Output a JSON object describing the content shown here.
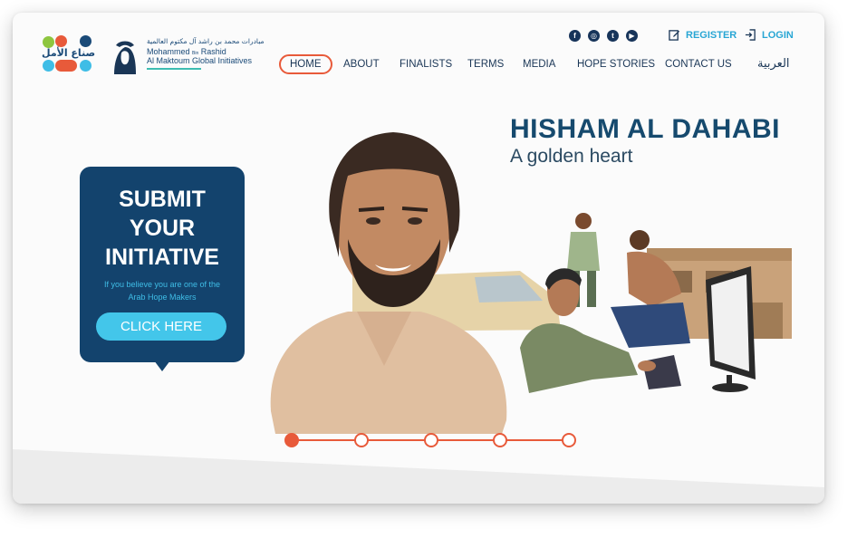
{
  "brand": {
    "hope_makers_arabic": "صناع الأمل",
    "org_arabic": "مبادرات محمد بن راشد آل مكتوم العالمية",
    "org_line1": "Mohammed",
    "org_line1_small": "Bin",
    "org_line1_rest": "Rashid",
    "org_line2": "Al Maktoum Global Initiatives"
  },
  "social": [
    {
      "icon": "facebook-icon",
      "glyph": "f"
    },
    {
      "icon": "instagram-icon",
      "glyph": "◎"
    },
    {
      "icon": "twitter-icon",
      "glyph": "t"
    },
    {
      "icon": "youtube-icon",
      "glyph": "▶"
    }
  ],
  "auth": {
    "register_label": "REGISTER",
    "login_label": "LOGIN"
  },
  "nav": {
    "home": "HOME",
    "about": "ABOUT",
    "finalists": "FINALISTS",
    "terms": "TERMS",
    "media": "MEDIA",
    "hope_stories": "HOPE STORIES",
    "contact_us": "CONTACT US",
    "language": "العربية",
    "active": "home"
  },
  "hero": {
    "title": "HISHAM AL DAHABI",
    "subtitle": "A golden heart"
  },
  "submit_card": {
    "line1": "SUBMIT",
    "line2": "YOUR",
    "line3": "INITIATIVE",
    "desc_line1": "If you believe you are one of the",
    "desc_line2": "Arab Hope Makers",
    "button_label": "CLICK HERE"
  },
  "slider": {
    "slide_count": 5,
    "active_index": 0
  },
  "colors": {
    "primary_navy": "#13436d",
    "accent_orange": "#e85a3a",
    "accent_cyan": "#43c6ea",
    "link_blue": "#28a6d4"
  }
}
